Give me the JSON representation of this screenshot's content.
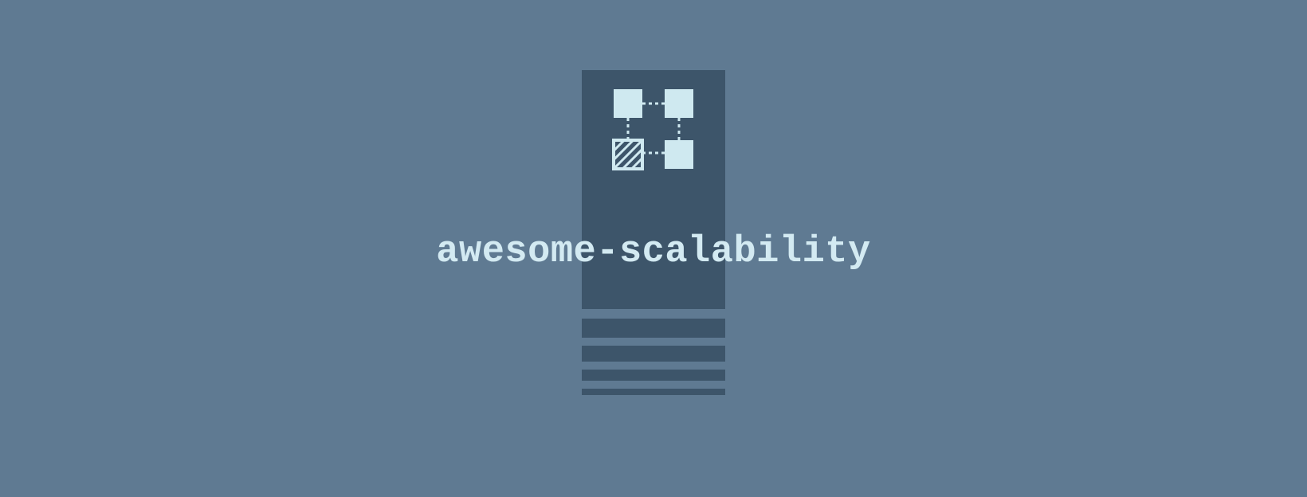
{
  "title": "awesome-scalability",
  "icon": "grid-nodes-icon",
  "colors": {
    "background": "#5f7a92",
    "panel": "#3d556a",
    "light": "#cfe9f0",
    "text": "#d3eaf2"
  }
}
